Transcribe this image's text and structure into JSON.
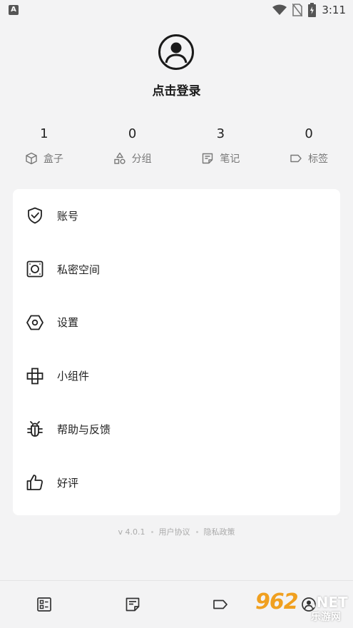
{
  "status_bar": {
    "app_indicator": "A",
    "time": "3:11",
    "icons": [
      "wifi-icon",
      "no-sim-icon",
      "battery-charging-icon"
    ]
  },
  "profile": {
    "avatar_icon": "user-circle-icon",
    "login_label": "点击登录"
  },
  "stats": [
    {
      "count": "1",
      "label": "盒子",
      "icon": "box-icon"
    },
    {
      "count": "0",
      "label": "分组",
      "icon": "shapes-icon"
    },
    {
      "count": "3",
      "label": "笔记",
      "icon": "note-icon"
    },
    {
      "count": "0",
      "label": "标签",
      "icon": "tag-icon"
    }
  ],
  "menu": [
    {
      "label": "账号",
      "icon": "shield-check-icon"
    },
    {
      "label": "私密空间",
      "icon": "safe-icon"
    },
    {
      "label": "设置",
      "icon": "hexagon-settings-icon"
    },
    {
      "label": "小组件",
      "icon": "widget-icon"
    },
    {
      "label": "帮助与反馈",
      "icon": "bug-icon"
    },
    {
      "label": "好评",
      "icon": "thumbs-up-icon"
    }
  ],
  "footer": {
    "version": "v 4.0.1",
    "user_agreement": "用户协议",
    "privacy_policy": "隐私政策"
  },
  "bottom_nav": [
    {
      "icon": "boxes-tab-icon"
    },
    {
      "icon": "notes-tab-icon"
    },
    {
      "icon": "tags-tab-icon"
    },
    {
      "icon": "profile-tab-icon"
    }
  ],
  "watermark": {
    "brand_number": "962",
    "brand_suffix": ".NET",
    "brand_name": "乐游网"
  },
  "colors": {
    "background": "#f3f3f4",
    "card": "#ffffff",
    "text_primary": "#222222",
    "text_secondary": "#777777",
    "watermark_orange": "#f0a020"
  }
}
